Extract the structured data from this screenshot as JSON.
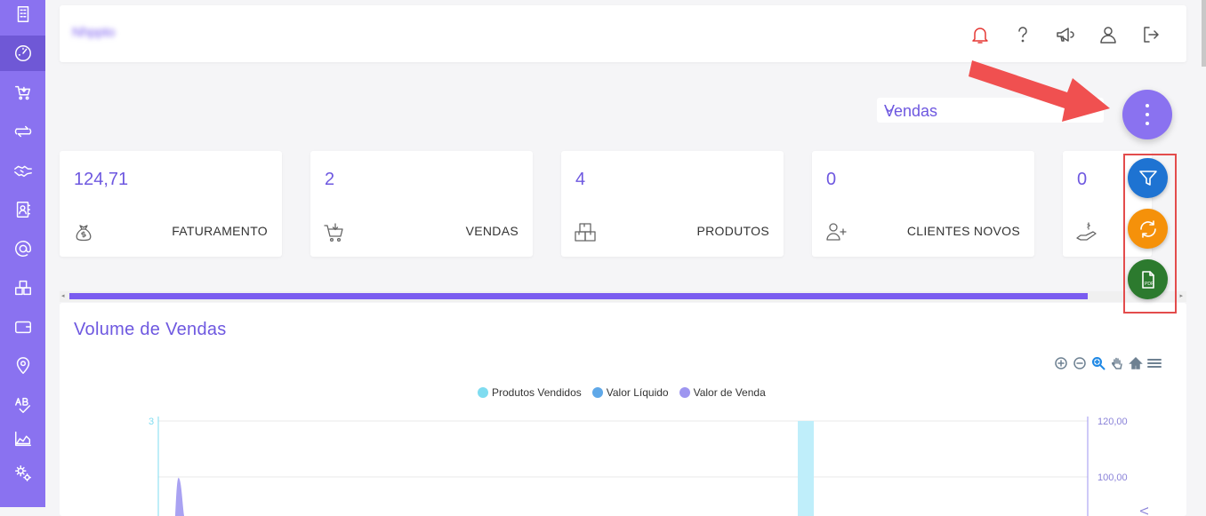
{
  "app": {
    "brand": "Nhppto"
  },
  "sidebar": {
    "items": [
      {
        "name": "dashboard-home",
        "icon": "building-icon"
      },
      {
        "name": "dashboard",
        "icon": "speedometer-icon",
        "active": true
      },
      {
        "name": "sales",
        "icon": "cart-icon"
      },
      {
        "name": "transfers",
        "icon": "exchange-icon"
      },
      {
        "name": "deals",
        "icon": "handshake-icon"
      },
      {
        "name": "contacts",
        "icon": "contact-book-icon"
      },
      {
        "name": "email",
        "icon": "at-icon"
      },
      {
        "name": "products",
        "icon": "boxes-icon"
      },
      {
        "name": "wallet",
        "icon": "wallet-icon"
      },
      {
        "name": "locations",
        "icon": "map-pin-icon"
      },
      {
        "name": "ab-test",
        "icon": "ab-check-icon"
      },
      {
        "name": "reports",
        "icon": "area-chart-icon"
      },
      {
        "name": "settings",
        "icon": "gears-icon"
      }
    ]
  },
  "topbar": {
    "icons": [
      "bell-icon",
      "help-icon",
      "megaphone-icon",
      "user-icon",
      "logout-icon"
    ]
  },
  "filter": {
    "selected": "Vendas"
  },
  "fab": {
    "main_icon": "more-vertical-icon",
    "actions": [
      {
        "name": "filter-action",
        "icon": "filter-icon",
        "color": "#1e73d2"
      },
      {
        "name": "refresh-action",
        "icon": "refresh-icon",
        "color": "#f5910a"
      },
      {
        "name": "pdf-action",
        "icon": "pdf-icon",
        "color": "#2c7a2e"
      }
    ]
  },
  "cards": [
    {
      "value": "124,71",
      "label": "FATURAMENTO",
      "icon": "money-bag-icon"
    },
    {
      "value": "2",
      "label": "VENDAS",
      "icon": "cart-icon"
    },
    {
      "value": "4",
      "label": "PRODUTOS",
      "icon": "boxes-icon"
    },
    {
      "value": "0",
      "label": "CLIENTES NOVOS",
      "icon": "user-plus-icon"
    },
    {
      "value": "0",
      "label": "",
      "icon": "hand-money-icon"
    }
  ],
  "chart": {
    "title": "Volume de Vendas",
    "toolbar": [
      "zoom-in-icon",
      "zoom-out-icon",
      "zoom-select-icon",
      "pan-icon",
      "reset-home-icon",
      "menu-icon"
    ],
    "legend": [
      {
        "label": "Produtos Vendidos",
        "color": "#7fdcf0"
      },
      {
        "label": "Valor Líquido",
        "color": "#5fa8e8"
      },
      {
        "label": "Valor de Venda",
        "color": "#9e96f0"
      }
    ]
  },
  "chart_data": {
    "type": "line",
    "title": "Volume de Vendas",
    "series": [
      {
        "name": "Produtos Vendidos",
        "axis": "left"
      },
      {
        "name": "Valor Líquido",
        "axis": "right"
      },
      {
        "name": "Valor de Venda",
        "axis": "right"
      }
    ],
    "y_left": {
      "ticks": [
        "3"
      ]
    },
    "y_right": {
      "ticks": [
        "120,00",
        "100,00"
      ],
      "label_partial": "V"
    }
  },
  "colors": {
    "primary": "#8a72f0",
    "accent": "#6e58e0",
    "annotation": "#e34c4c"
  }
}
